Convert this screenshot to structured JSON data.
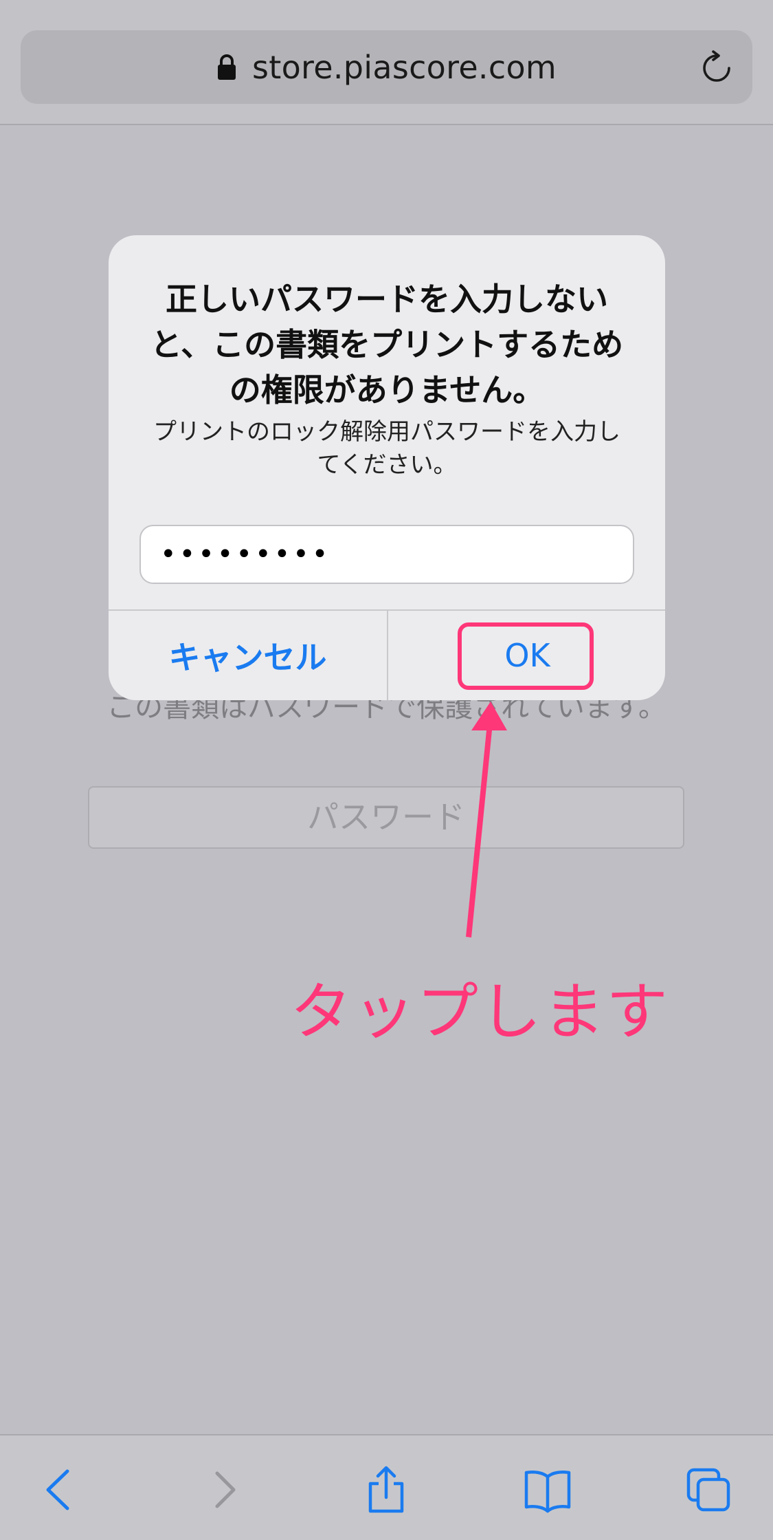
{
  "browser": {
    "url": "store.piascore.com",
    "icons": {
      "lock": "lock-icon",
      "reload": "reload-icon"
    }
  },
  "page": {
    "description": "この書類はパスワードで保護されています。",
    "password_placeholder": "パスワード"
  },
  "alert": {
    "title": "正しいパスワードを入力しないと、この書類をプリントするための権限がありません。",
    "message": "プリントのロック解除用パスワードを入力してください。",
    "input_value": "•••••••••",
    "cancel_label": "キャンセル",
    "ok_label": "OK"
  },
  "annotation": {
    "text": "タップします",
    "color": "#fe3779"
  },
  "toolbar": {
    "icons": [
      "back-icon",
      "forward-icon",
      "share-icon",
      "bookmarks-icon",
      "tabs-icon"
    ]
  },
  "colors": {
    "accent": "#1a7bf0",
    "annotation": "#fe3779"
  }
}
